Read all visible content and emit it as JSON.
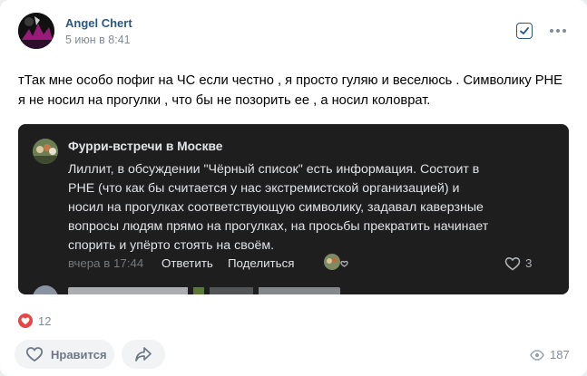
{
  "post": {
    "author": "Angel Chert",
    "date": "5 июн в 8:41",
    "text": "тТак мне особо пофиг на ЧС если честно , я просто гуляю и веселюсь . Символику РНЕ я не носил на прогулки , что бы не позорить ее , а носил коловрат."
  },
  "screenshot": {
    "group_name": "Фурри-встречи в Москве",
    "body": "Лиллит, в обсуждении \"Чёрный список\" есть информация. Состоит в РНЕ (что как бы считается у нас экстремистской организацией) и носил на прогулках соответствующую символику, задавал каверзные вопросы людям прямо на прогулках, на просьбы прекратить начинает спорить и упёрто стоять на своём.",
    "time": "вчера в 17:44",
    "reply": "Ответить",
    "share": "Поделиться",
    "likes": "3"
  },
  "footer": {
    "reactions_count": "12",
    "like_label": "Нравится",
    "views": "187"
  },
  "colors": {
    "accent": "#2a5885",
    "heart": "#e64646",
    "muted": "#818c99",
    "dark_bg": "#1e1e1f"
  },
  "icons": [
    "check-icon",
    "more-icon",
    "heart-icon",
    "share-icon",
    "eye-icon",
    "reaction-icon"
  ]
}
